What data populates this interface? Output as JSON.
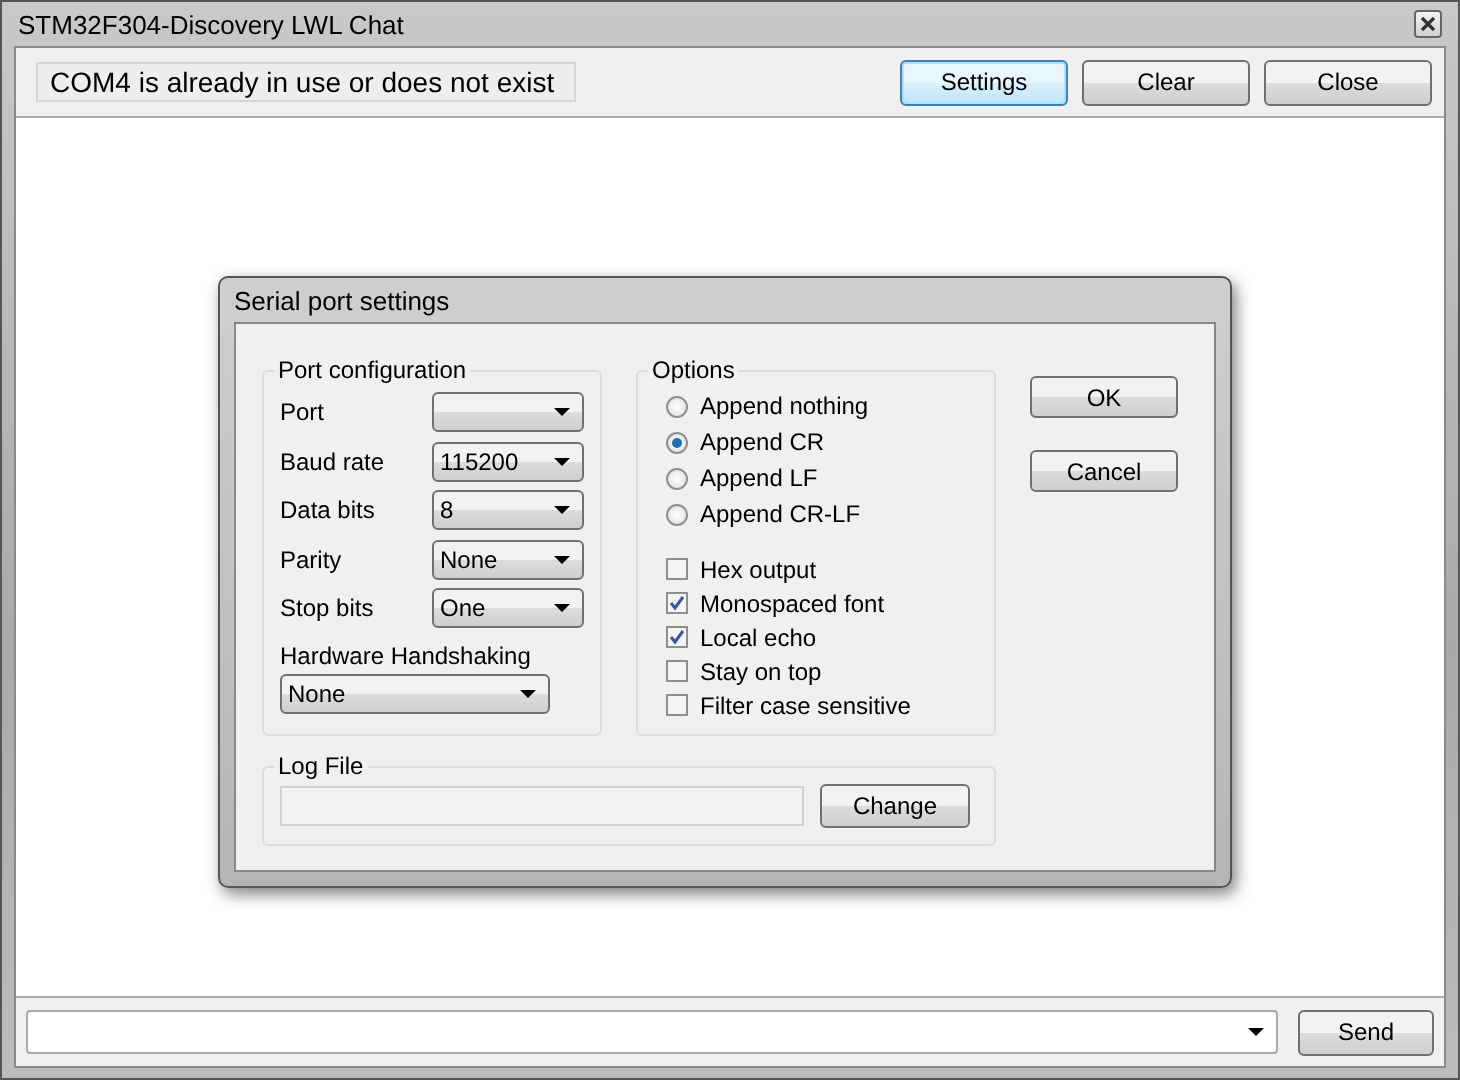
{
  "window": {
    "title": "STM32F304-Discovery LWL Chat"
  },
  "status": "COM4 is already in use or does not exist",
  "toolbar_buttons": [
    {
      "label": "Settings",
      "focused": true
    },
    {
      "label": "Clear",
      "focused": false
    },
    {
      "label": "Close",
      "focused": false
    }
  ],
  "dialog": {
    "title": "Serial port settings",
    "port_configuration": {
      "title": "Port configuration",
      "fields": [
        {
          "label": "Port"
        },
        {
          "label": "Baud rate",
          "value": "115200"
        },
        {
          "label": "Data bits",
          "value": "8"
        },
        {
          "label": "Parity",
          "value": "None"
        },
        {
          "label": "Stop bits",
          "value": "One"
        }
      ],
      "handshaking": {
        "label": "Hardware Handshaking",
        "value": "None"
      }
    },
    "options": {
      "title": "Options",
      "radios": [
        {
          "label": "Append nothing",
          "selected": false
        },
        {
          "label": "Append CR",
          "selected": true
        },
        {
          "label": "Append LF",
          "selected": false
        },
        {
          "label": "Append CR-LF",
          "selected": false
        }
      ],
      "checkboxes": [
        {
          "label": "Hex output",
          "checked": false
        },
        {
          "label": "Monospaced font",
          "checked": true
        },
        {
          "label": "Local echo",
          "checked": true
        },
        {
          "label": "Stay on top",
          "checked": false
        },
        {
          "label": "Filter case sensitive",
          "checked": false
        }
      ]
    },
    "buttons": [
      "OK",
      "Cancel"
    ],
    "log_file": {
      "title": "Log File",
      "button": "Change"
    }
  },
  "send_button": "Send"
}
